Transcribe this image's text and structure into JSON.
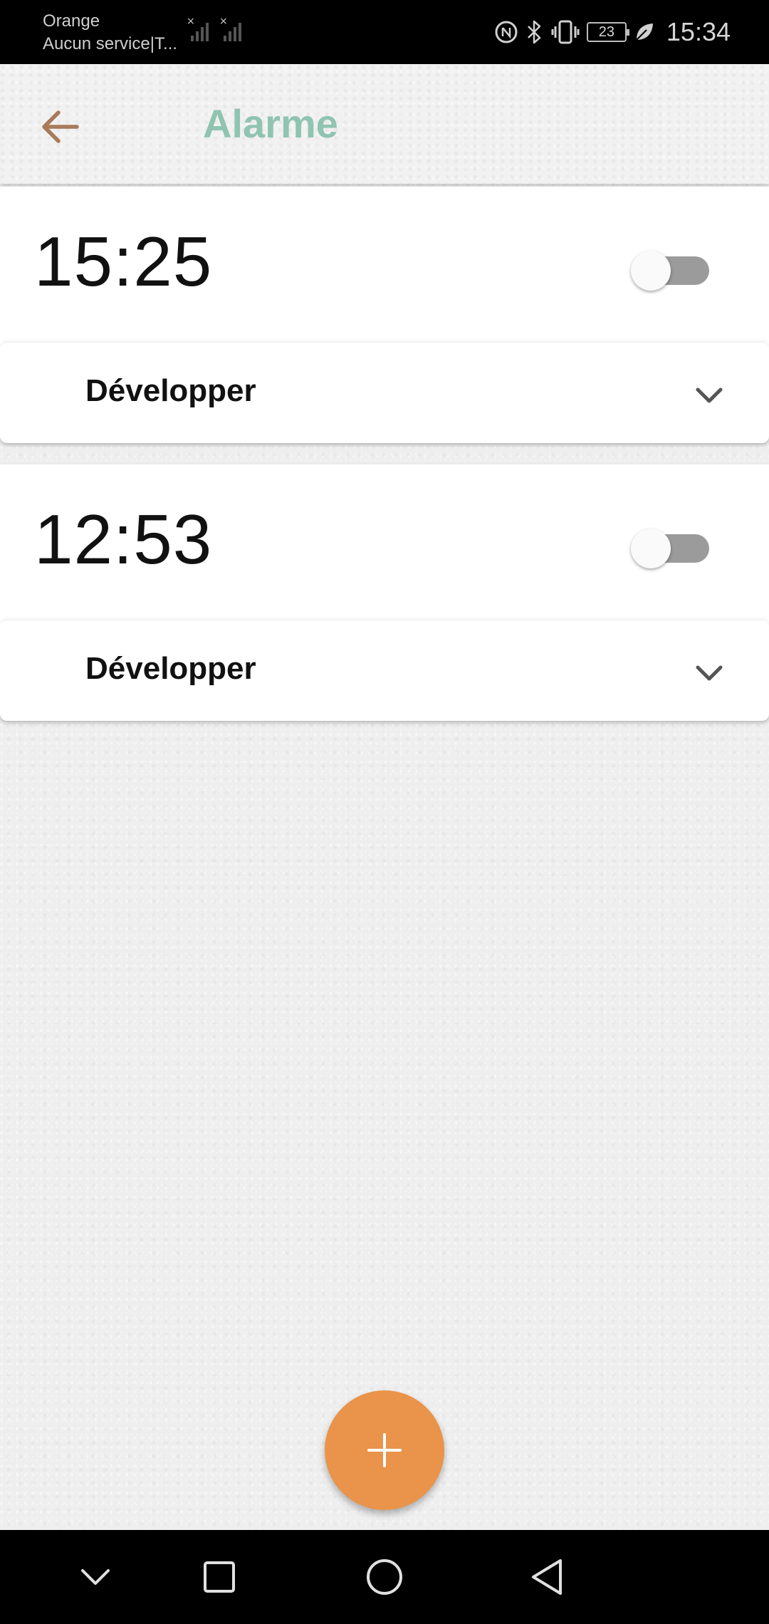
{
  "status_bar": {
    "carrier_name": "Orange",
    "carrier_status": "Aucun service|T...",
    "battery_level": "23",
    "time": "15:34",
    "icons": [
      "no-signal-icon",
      "no-signal-icon",
      "nfc-icon",
      "bluetooth-icon",
      "vibrate-icon",
      "battery-icon",
      "power-saving-leaf-icon"
    ]
  },
  "app_bar": {
    "back_icon": "arrow-left-icon",
    "title": "Alarme",
    "title_color": "#8fc4b1",
    "back_icon_color": "#a87a5a"
  },
  "alarms": [
    {
      "time": "15:25",
      "enabled": false,
      "expand_label": "Développer",
      "expand_icon": "chevron-down-icon"
    },
    {
      "time": "12:53",
      "enabled": false,
      "expand_label": "Développer",
      "expand_icon": "chevron-down-icon"
    }
  ],
  "fab": {
    "icon": "plus-icon",
    "color": "#e9944a"
  },
  "nav_bar": {
    "buttons": [
      "chevron-down-icon",
      "recents-square-icon",
      "home-circle-icon",
      "back-triangle-icon"
    ]
  }
}
